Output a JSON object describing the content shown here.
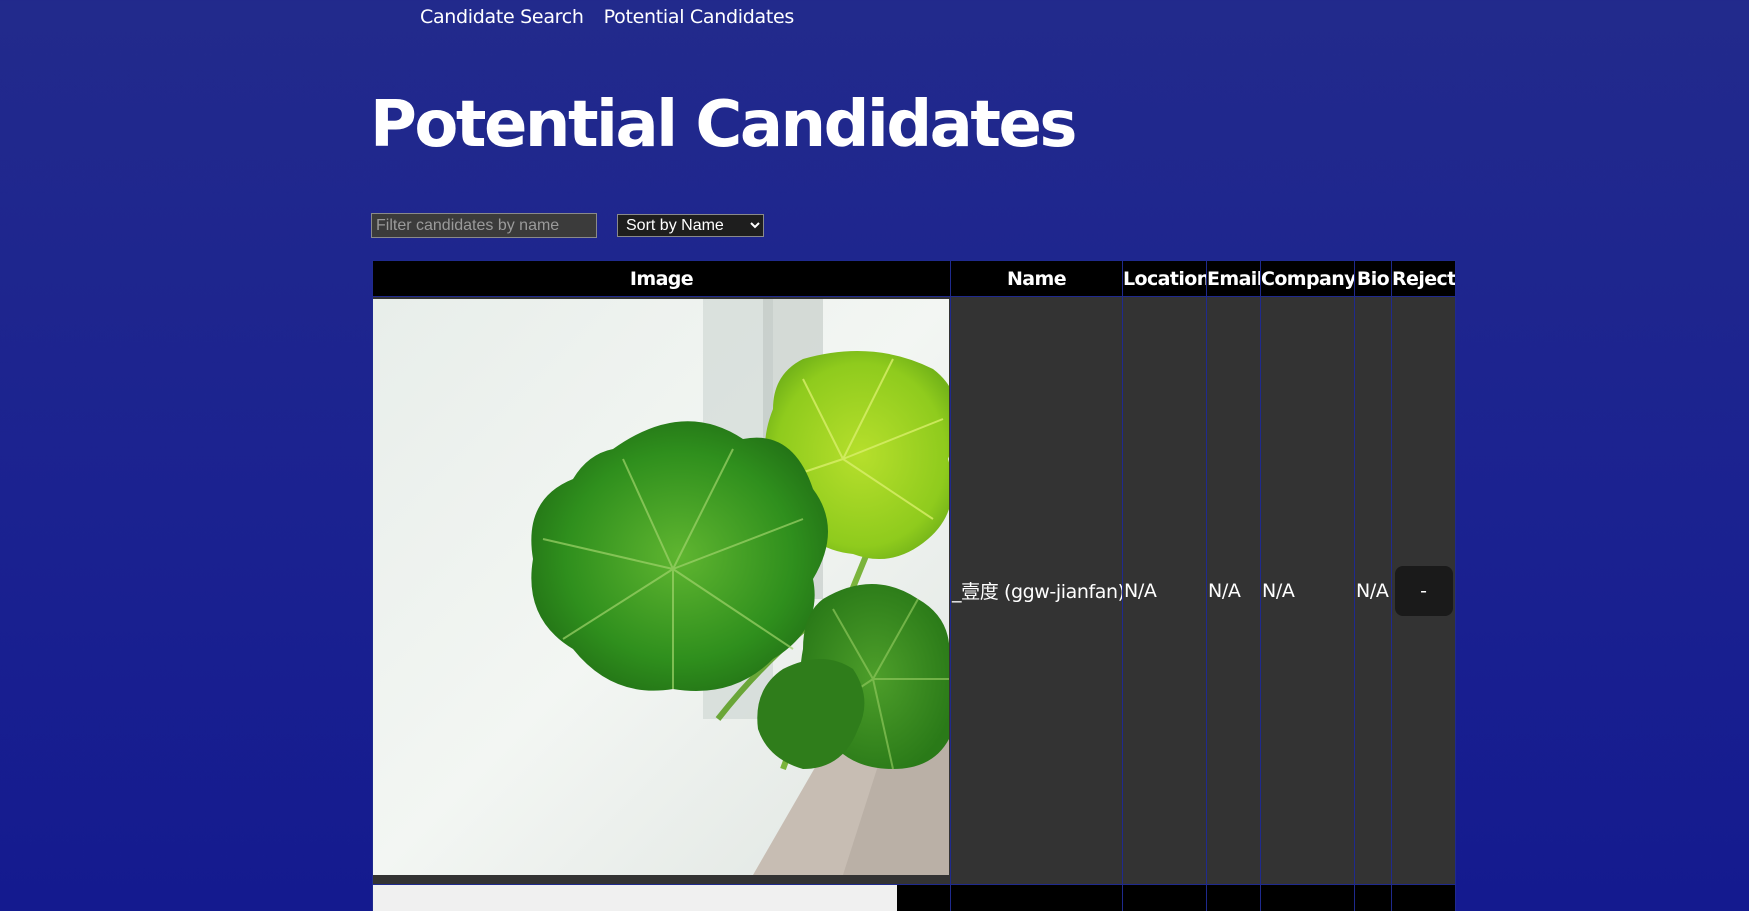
{
  "nav": {
    "links": [
      {
        "label": "Candidate Search"
      },
      {
        "label": "Potential Candidates"
      }
    ]
  },
  "page": {
    "title": "Potential Candidates"
  },
  "controls": {
    "filter_placeholder": "Filter candidates by name",
    "filter_value": "",
    "sort_options": [
      "Sort by Name"
    ],
    "sort_selected": "Sort by Name"
  },
  "table": {
    "headers": [
      "Image",
      "Name",
      "Location",
      "Email",
      "Company",
      "Bio",
      "Reject"
    ],
    "rows": [
      {
        "image": "leafy-plant-avatar",
        "name": "_壹度 (ggw-jianfan)",
        "location": "N/A",
        "email": "N/A",
        "company": "N/A",
        "bio": "N/A",
        "reject_label": "-"
      }
    ]
  },
  "colors": {
    "background_top": "#222a8c",
    "background_bottom": "#141a8f",
    "table_header": "#000000",
    "table_cell": "#333333",
    "reject_button": "#1a1a1a",
    "leaf_green": "#3a9a1f",
    "leaf_lime": "#a9d61c"
  }
}
